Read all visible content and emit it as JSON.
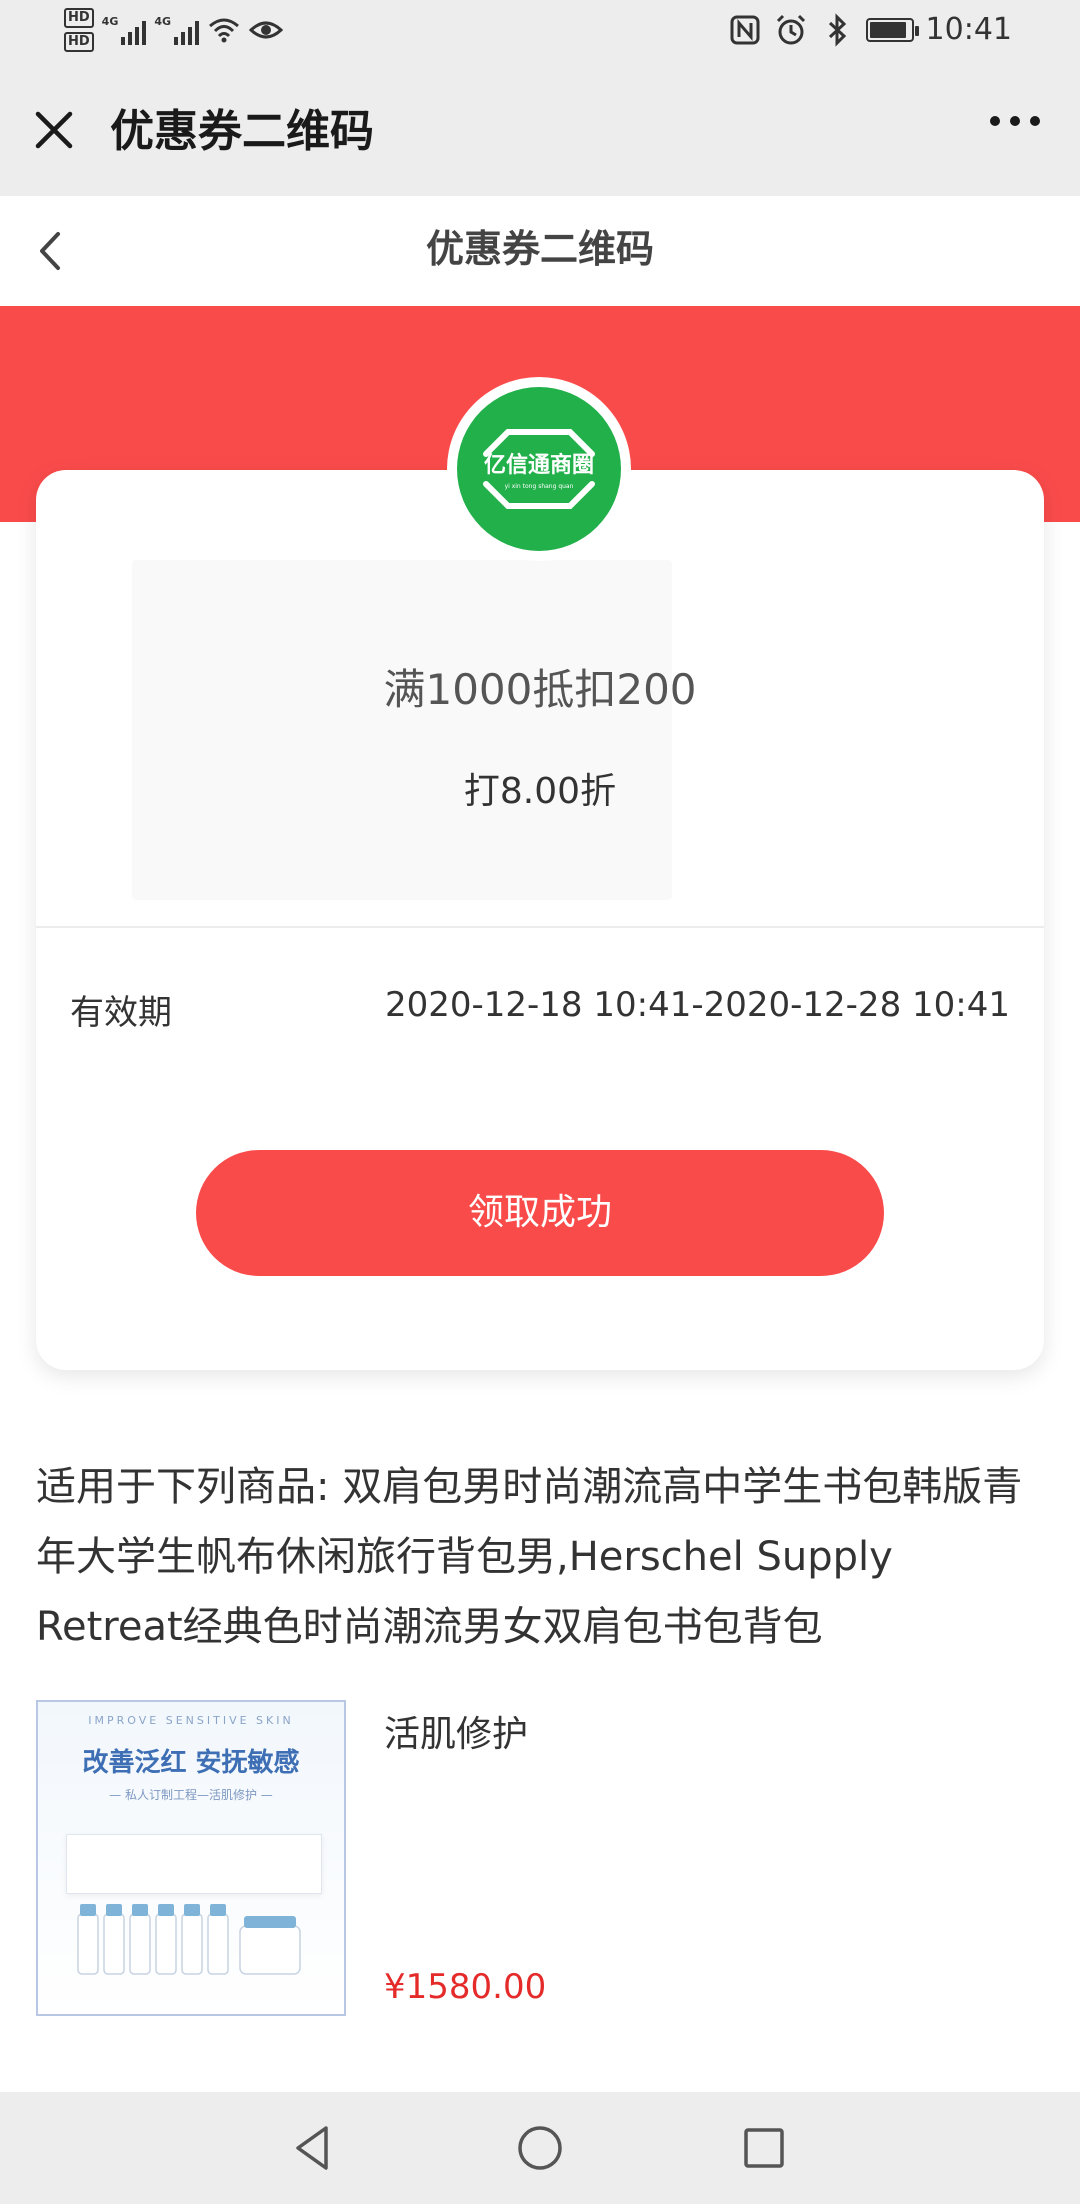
{
  "status_bar": {
    "hd_label": "HD",
    "signal_tag": "4G",
    "time": "10:41"
  },
  "header": {
    "title": "优惠券二维码"
  },
  "page": {
    "title": "优惠券二维码"
  },
  "logo": {
    "text": "亿信通商圈",
    "pinyin": "yi xin tong shang quan",
    "color": "#22b04b"
  },
  "coupon": {
    "description": "满1000抵扣200",
    "discount": "打8.00折",
    "validity_label": "有效期",
    "validity_value": "2020-12-18 10:41-2020-12-28 10:41",
    "button_label": "领取成功",
    "accent": "#fa4b4b"
  },
  "applicable": {
    "text": "适用于下列商品: 双肩包男时尚潮流高中学生书包韩版青年大学生帆布休闲旅行背包男,Herschel Supply Retreat经典色时尚潮流男女双肩包书包背包"
  },
  "product": {
    "image": {
      "en_text": "IMPROVE SENSITIVE SKIN",
      "cn_text": "改善泛红 安抚敏感",
      "sub_text": "— 私人订制工程—活肌修护 —"
    },
    "name": "活肌修护",
    "price": "¥1580.00",
    "price_color": "#e52a2a"
  },
  "icons": {
    "close": "close-icon",
    "more": "more-icon",
    "back": "chevron-left-icon",
    "nav_back": "triangle-back-icon",
    "nav_home": "circle-home-icon",
    "nav_recent": "square-recent-icon"
  }
}
